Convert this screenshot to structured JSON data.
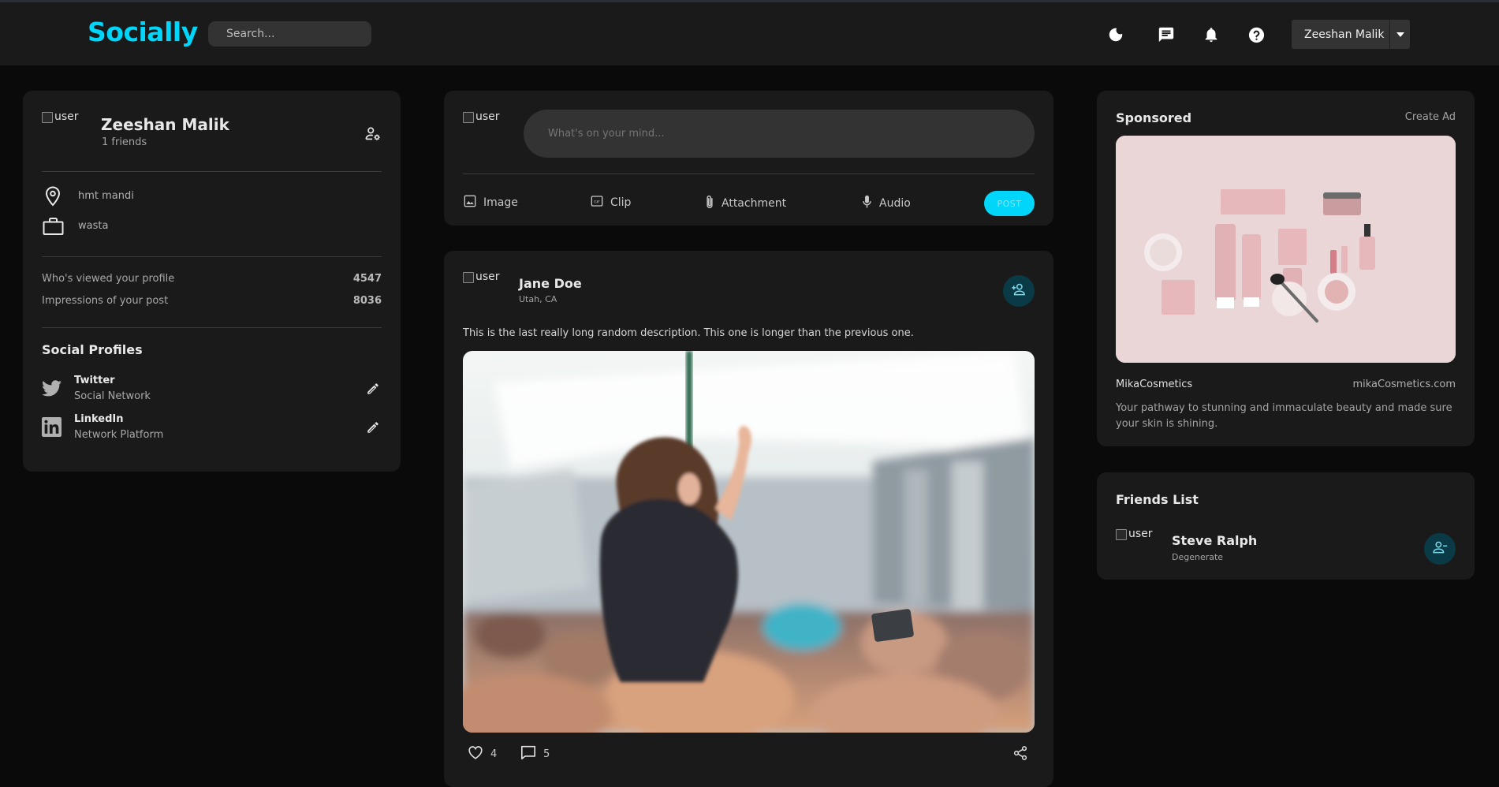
{
  "app": {
    "logo": "Socially"
  },
  "search": {
    "placeholder": "Search..."
  },
  "header": {
    "user_name": "Zeeshan Malik"
  },
  "profile": {
    "img_alt": "user",
    "name": "Zeeshan Malik",
    "friends": "1 friends",
    "location": "hmt mandi",
    "occupation": "wasta",
    "stats": [
      {
        "label": "Who's viewed your profile",
        "value": "4547"
      },
      {
        "label": "Impressions of your post",
        "value": "8036"
      }
    ],
    "social_title": "Social Profiles",
    "socials": [
      {
        "name": "Twitter",
        "type": "Social Network"
      },
      {
        "name": "LinkedIn",
        "type": "Network Platform"
      }
    ]
  },
  "composer": {
    "img_alt": "user",
    "placeholder": "What's on your mind...",
    "actions": [
      {
        "label": "Image",
        "icon": "image-icon"
      },
      {
        "label": "Clip",
        "icon": "gif-icon"
      },
      {
        "label": "Attachment",
        "icon": "paperclip-icon"
      },
      {
        "label": "Audio",
        "icon": "microphone-icon"
      }
    ],
    "post_label": "POST"
  },
  "post": {
    "img_alt": "user",
    "author": "Jane Doe",
    "location": "Utah, CA",
    "description": "This is the last really long random description. This one is longer than the previous one.",
    "likes": "4",
    "comments": "5"
  },
  "sponsored": {
    "title": "Sponsored",
    "create_ad": "Create Ad",
    "brand": "MikaCosmetics",
    "url": "mikaCosmetics.com",
    "text": "Your pathway to stunning and immaculate beauty and made sure your skin is shining."
  },
  "friends": {
    "title": "Friends List",
    "items": [
      {
        "img_alt": "user",
        "name": "Steve Ralph",
        "subtitle": "Degenerate"
      }
    ]
  },
  "colors": {
    "accent": "#00d5fa",
    "card": "#1a1a1a",
    "background": "#0a0a0a"
  }
}
